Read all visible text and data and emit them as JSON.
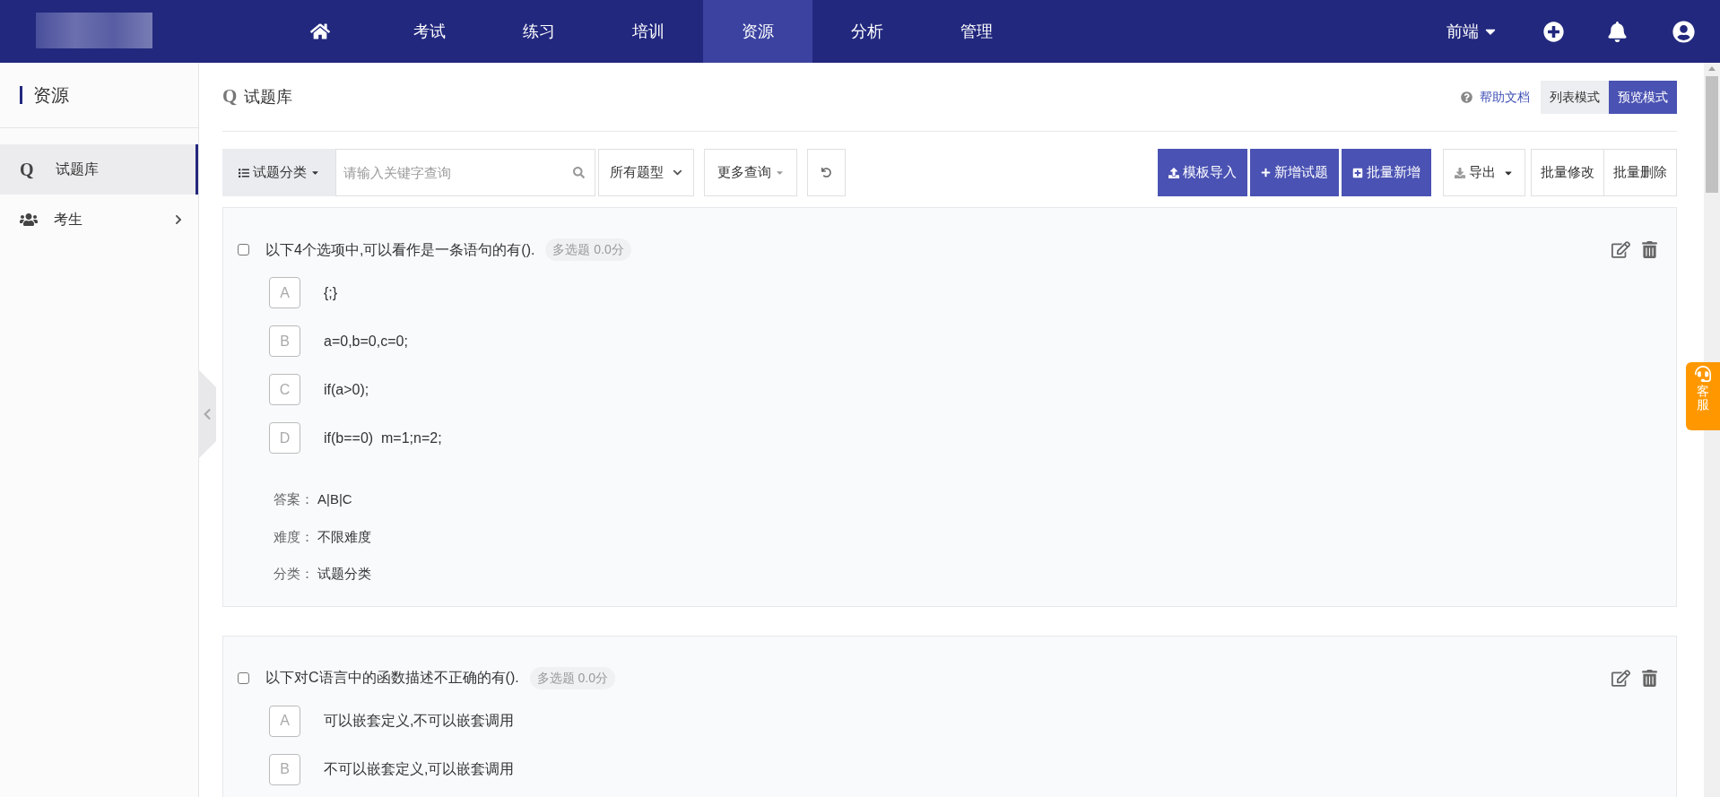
{
  "navbar": {
    "items": [
      {
        "kind": "home",
        "selected": false
      },
      {
        "kind": "text",
        "label": "考试",
        "selected": false
      },
      {
        "kind": "text",
        "label": "练习",
        "selected": false
      },
      {
        "kind": "text",
        "label": "培训",
        "selected": false
      },
      {
        "kind": "text",
        "label": "资源",
        "selected": true
      },
      {
        "kind": "text",
        "label": "分析",
        "selected": false
      },
      {
        "kind": "text",
        "label": "管理",
        "selected": false
      }
    ],
    "workspace": "前端"
  },
  "sidebar": {
    "title": "资源",
    "items": [
      {
        "kind": "bank",
        "icon_text": "Q",
        "label": "试题库",
        "selected": true,
        "expandable": false
      },
      {
        "kind": "users",
        "label": "考生",
        "selected": false,
        "expandable": true
      }
    ]
  },
  "page": {
    "title_icon": "Q",
    "title": "试题库",
    "help_link": "帮助文档",
    "view_modes": [
      {
        "label": "列表模式",
        "selected": false
      },
      {
        "label": "预览模式",
        "selected": true
      }
    ]
  },
  "toolbar": {
    "category_button": "试题分类",
    "search": {
      "placeholder": "请输入关键字查询"
    },
    "type_select": "所有题型",
    "more_query": "更多查询",
    "primary_buttons": [
      {
        "kind": "upload",
        "label": "模板导入"
      },
      {
        "kind": "plus",
        "label": "新增试题"
      },
      {
        "kind": "plus-square",
        "label": "批量新增"
      }
    ],
    "export_button": "导出",
    "batch_buttons": [
      "批量修改",
      "批量删除"
    ]
  },
  "questions": [
    {
      "checked": false,
      "text": "以下4个选项中,可以看作是一条语句的有().",
      "tag": "多选题 0.0分",
      "options": [
        {
          "letter": "A",
          "text": "{;}"
        },
        {
          "letter": "B",
          "text": "a=0,b=0,c=0;"
        },
        {
          "letter": "C",
          "text": "if(a>0);"
        },
        {
          "letter": "D",
          "text": "if(b==0)  m=1;n=2;"
        }
      ],
      "meta": [
        {
          "label": "答案：",
          "value": "A|B|C"
        },
        {
          "label": "难度：",
          "value": "不限难度"
        },
        {
          "label": "分类：",
          "value": "试题分类"
        }
      ]
    },
    {
      "checked": false,
      "text": "以下对C语言中的函数描述不正确的有().",
      "tag": "多选题 0.0分",
      "options": [
        {
          "letter": "A",
          "text": "可以嵌套定义,不可以嵌套调用"
        },
        {
          "letter": "B",
          "text": "不可以嵌套定义,可以嵌套调用"
        }
      ]
    }
  ],
  "service_tab": "客服"
}
